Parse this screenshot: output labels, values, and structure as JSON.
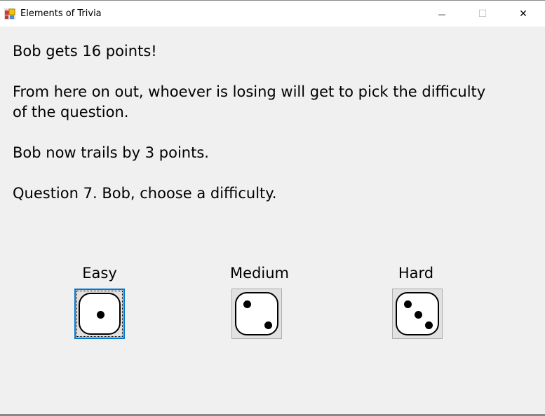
{
  "window": {
    "title": "Elements of Trivia",
    "minimize": "—",
    "maximize": "☐",
    "close": "✕"
  },
  "message": {
    "lines": [
      "Bob gets 16 points!",
      "",
      "From here on out, whoever is losing will get to pick the difficulty",
      "of the question.",
      "",
      "Bob now trails by 3 points.",
      "",
      "Question 7. Bob, choose a difficulty."
    ]
  },
  "difficulty": {
    "easy": {
      "label": "Easy",
      "pips": 1
    },
    "medium": {
      "label": "Medium",
      "pips": 2
    },
    "hard": {
      "label": "Hard",
      "pips": 3
    },
    "focused": "Easy"
  },
  "colors": {
    "focus": "#0078d7"
  }
}
